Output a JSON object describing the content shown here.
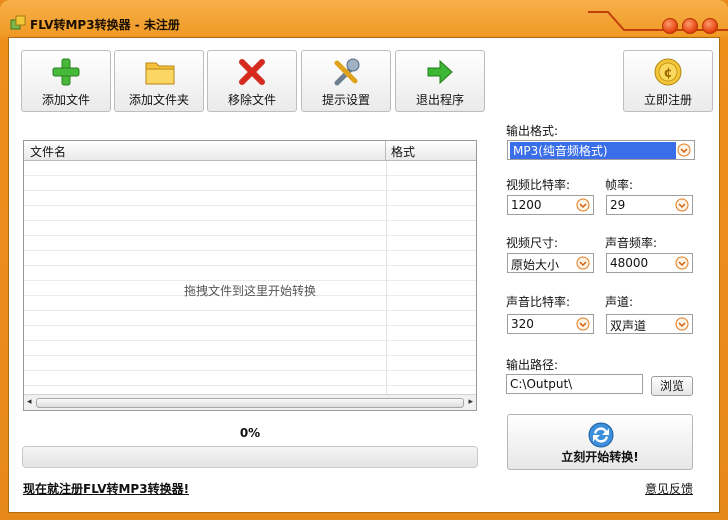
{
  "window": {
    "title": "FLV转MP3转换器 - 未注册"
  },
  "toolbar": {
    "add_file": "添加文件",
    "add_folder": "添加文件夹",
    "remove_file": "移除文件",
    "prompt_settings": "提示设置",
    "exit_program": "退出程序",
    "register_now": "立即注册"
  },
  "file_list": {
    "columns": [
      "文件名",
      "格式"
    ],
    "drop_hint": "拖拽文件到这里开始转换"
  },
  "progress": {
    "percent_label": "0%",
    "value": 0
  },
  "settings": {
    "output_format_label": "输出格式:",
    "output_format_value": "MP3(纯音频格式)",
    "video_bitrate_label": "视频比特率:",
    "video_bitrate_value": "1200",
    "framerate_label": "帧率:",
    "framerate_value": "29",
    "video_size_label": "视频尺寸:",
    "video_size_value": "原始大小",
    "sample_rate_label": "声音频率:",
    "sample_rate_value": "48000",
    "audio_bitrate_label": "声音比特率:",
    "audio_bitrate_value": "320",
    "channels_label": "声道:",
    "channels_value": "双声道",
    "output_path_label": "输出路径:",
    "output_path_value": "C:\\Output\\",
    "browse_label": "浏览"
  },
  "start_button": {
    "label": "立刻开始转换!"
  },
  "footer": {
    "register_link": "现在就注册FLV转MP3转换器!",
    "feedback_link": "意见反馈"
  },
  "colors": {
    "frame_orange": "#ee8f1c",
    "selection_blue": "#3a6ee8",
    "progress_green": "#48b848"
  }
}
